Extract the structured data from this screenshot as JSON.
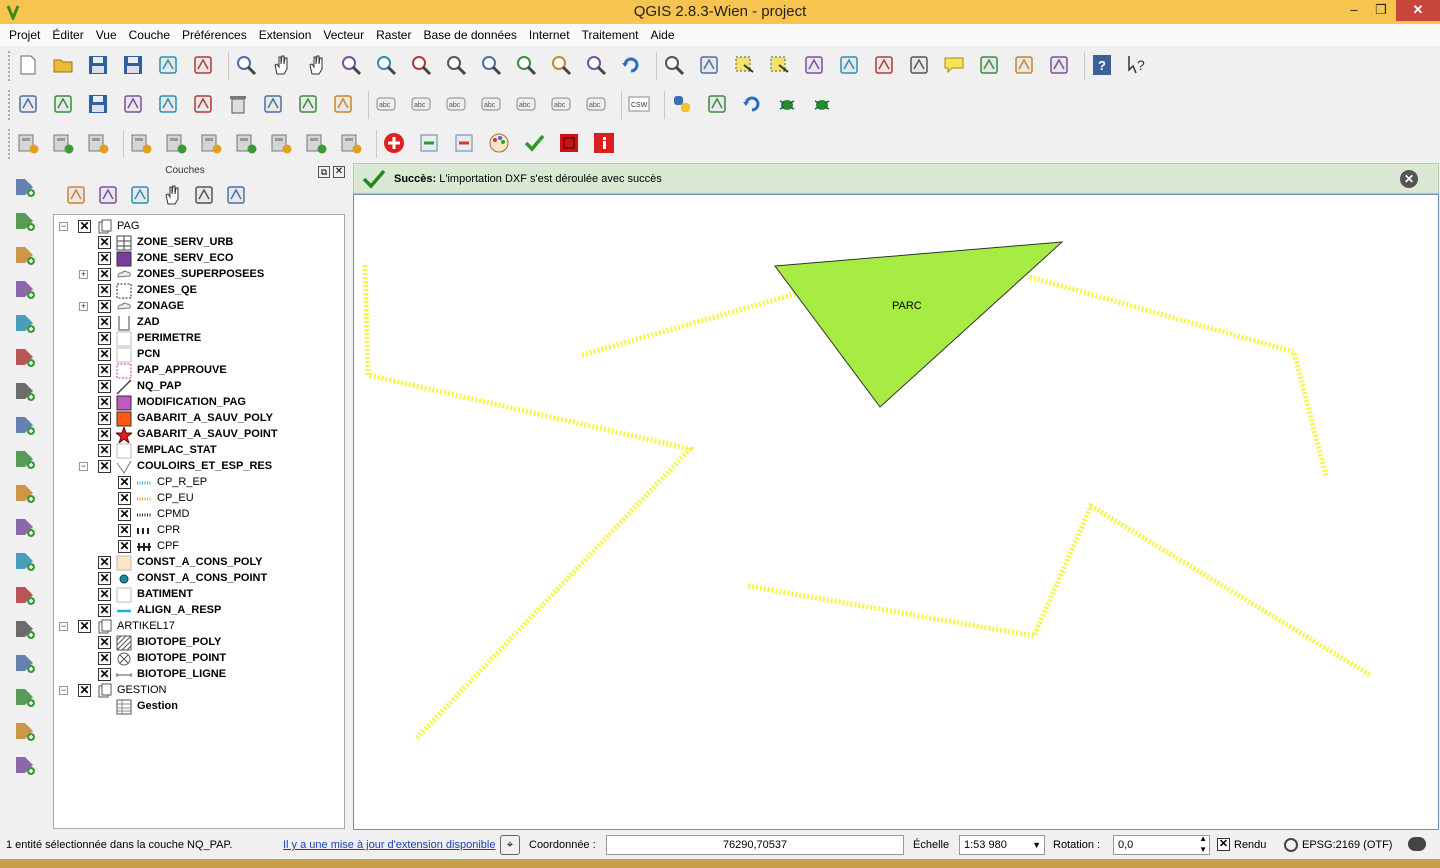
{
  "window": {
    "title": "QGIS 2.8.3-Wien - project",
    "minimize": "–",
    "maximize": "❒",
    "close": "✕"
  },
  "menu": [
    "Projet",
    "Éditer",
    "Vue",
    "Couche",
    "Préférences",
    "Extension",
    "Vecteur",
    "Raster",
    "Base de données",
    "Internet",
    "Traitement",
    "Aide"
  ],
  "toolbars": {
    "row1": [
      "new-project-icon",
      "open-project-icon",
      "save-project-icon",
      "save-as-icon",
      "new-print-composer-icon",
      "composer-manager-icon",
      "|",
      "touch-zoom-icon",
      "pan-icon",
      "pan-to-selection-icon",
      "zoom-in-icon",
      "zoom-out-icon",
      "zoom-actual-icon",
      "zoom-full-icon",
      "zoom-to-selection-icon",
      "zoom-to-layer-icon",
      "zoom-last-icon",
      "zoom-next-icon",
      "refresh-icon",
      "|",
      "identify-icon",
      "action-icon",
      "select-feature-icon",
      "deselect-icon",
      "field-calculator-icon",
      "attribute-table-icon",
      "statistics-icon",
      "measure-icon",
      "map-tip-icon",
      "new-bookmark-icon",
      "show-bookmarks-icon",
      "text-annotation-icon",
      "|",
      "help-icon",
      "whats-this-icon"
    ],
    "row2": [
      "current-edits-icon",
      "toggle-editing-icon",
      "save-edits-icon",
      "add-feature-icon",
      "move-feature-icon",
      "node-tool-icon",
      "delete-selected-icon",
      "cut-features-icon",
      "copy-features-icon",
      "paste-features-icon",
      "|",
      "label-icon",
      "highlight-pinned-label-icon",
      "pin-label-icon",
      "show-hide-label-icon",
      "move-label-icon",
      "rotate-label-icon",
      "change-label-icon",
      "|",
      "csw-icon",
      "|",
      "python-console-icon",
      "plugin-tool-icon",
      "undo-plugin-icon",
      "plugin-bug-icon",
      "plugin-gear-bug-icon"
    ],
    "row3": [
      "add-layer-a-icon",
      "add-layer-b-icon",
      "add-layer-c-icon",
      "|",
      "new-shape-a-icon",
      "new-shape-b-icon",
      "new-shape-c-icon",
      "new-shape-d-icon",
      "new-shape-e-icon",
      "new-shape-f-icon",
      "new-shape-g-icon",
      "|",
      "plus-circle-icon",
      "import-icon",
      "export-icon",
      "color-palette-icon",
      "check-icon",
      "red-square-icon",
      "red-info-icon"
    ]
  },
  "left_toolbar": [
    "add-vector-layer-icon",
    "add-raster-layer-icon",
    "add-postgis-layer-icon",
    "add-spatialite-layer-icon",
    "add-mssql-layer-icon",
    "add-oracle-layer-icon",
    "add-db2-layer-icon",
    "add-wms-layer-icon",
    "add-wcs-layer-icon",
    "add-wfs-layer-icon",
    "add-delimited-text-icon",
    "new-shapefile-icon",
    "virtual-layer-icon",
    "georeferencer-icon",
    "gps-tool-icon",
    "coordinate-capture-icon",
    "vertex-tool-icon",
    "geometry-checker-icon"
  ],
  "layers_panel": {
    "title": "Couches",
    "float_btn": "⧉",
    "close_btn": "✕",
    "panel_tools": [
      "add-group-icon",
      "visibility-icon",
      "filter-icon",
      "expand-icon",
      "collapse-icon",
      "remove-layer-icon"
    ],
    "items": [
      {
        "name": "PAG",
        "level": 0,
        "bold": false,
        "group": true,
        "expander": "−",
        "symbol": "group"
      },
      {
        "name": "ZONE_SERV_URB",
        "level": 1,
        "bold": true,
        "symbol": "grid"
      },
      {
        "name": "ZONE_SERV_ECO",
        "level": 1,
        "bold": true,
        "symbol": "purple-fill"
      },
      {
        "name": "ZONES_SUPERPOSEES",
        "level": 1,
        "bold": true,
        "expander": "+",
        "symbol": "cloud"
      },
      {
        "name": "ZONES_QE",
        "level": 1,
        "bold": true,
        "symbol": "dashed-box"
      },
      {
        "name": "ZONAGE",
        "level": 1,
        "bold": true,
        "expander": "+",
        "symbol": "cloud"
      },
      {
        "name": "ZAD",
        "level": 1,
        "bold": true,
        "symbol": "bracket"
      },
      {
        "name": "PERIMETRE",
        "level": 1,
        "bold": true,
        "symbol": "white-box"
      },
      {
        "name": "PCN",
        "level": 1,
        "bold": true,
        "symbol": "white-box"
      },
      {
        "name": "PAP_APPROUVE",
        "level": 1,
        "bold": true,
        "symbol": "pink-dashed"
      },
      {
        "name": "NQ_PAP",
        "level": 1,
        "bold": true,
        "symbol": "diagonal-line"
      },
      {
        "name": "MODIFICATION_PAG",
        "level": 1,
        "bold": true,
        "symbol": "violet-fill"
      },
      {
        "name": "GABARIT_A_SAUV_POLY",
        "level": 1,
        "bold": true,
        "symbol": "orange-fill"
      },
      {
        "name": "GABARIT_A_SAUV_POINT",
        "level": 1,
        "bold": true,
        "symbol": "red-star"
      },
      {
        "name": "EMPLAC_STAT",
        "level": 1,
        "bold": true,
        "symbol": "white-box"
      },
      {
        "name": "COULOIRS_ET_ESP_RES",
        "level": 1,
        "bold": true,
        "expander": "−",
        "symbol": "v-line"
      },
      {
        "name": "CP_R_EP",
        "level": 2,
        "bold": false,
        "symbol": "blue-dotted"
      },
      {
        "name": "CP_EU",
        "level": 2,
        "bold": false,
        "symbol": "orange-dotted"
      },
      {
        "name": "CPMD",
        "level": 2,
        "bold": false,
        "symbol": "black-dotted"
      },
      {
        "name": "CPR",
        "level": 2,
        "bold": false,
        "symbol": "black-dashed"
      },
      {
        "name": "CPF",
        "level": 2,
        "bold": false,
        "symbol": "black-hbar"
      },
      {
        "name": "CONST_A_CONS_POLY",
        "level": 1,
        "bold": true,
        "symbol": "beige-fill"
      },
      {
        "name": "CONST_A_CONS_POINT",
        "level": 1,
        "bold": true,
        "symbol": "teal-dot"
      },
      {
        "name": "BATIMENT",
        "level": 1,
        "bold": true,
        "symbol": "white-box"
      },
      {
        "name": "ALIGN_A_RESP",
        "level": 1,
        "bold": true,
        "symbol": "cyan-line"
      },
      {
        "name": "ARTIKEL17",
        "level": 0,
        "bold": false,
        "group": true,
        "expander": "−",
        "symbol": "group"
      },
      {
        "name": "BIOTOPE_POLY",
        "level": 1,
        "bold": true,
        "symbol": "hatched"
      },
      {
        "name": "BIOTOPE_POINT",
        "level": 1,
        "bold": true,
        "symbol": "circle-x"
      },
      {
        "name": "BIOTOPE_LIGNE",
        "level": 1,
        "bold": true,
        "symbol": "line-bracket"
      },
      {
        "name": "GESTION",
        "level": 0,
        "bold": false,
        "group": true,
        "expander": "−",
        "symbol": "group"
      },
      {
        "name": "Gestion",
        "level": 1,
        "bold": true,
        "nocheck": true,
        "symbol": "table"
      }
    ]
  },
  "message": {
    "title": "Succès:",
    "text": "L'importation DXF s'est déroulée avec succès",
    "close": "✕"
  },
  "map": {
    "label": "PARC",
    "polygon_fill": "#a6ec42",
    "line_color": "#f5f542"
  },
  "status": {
    "selection": "1 entité sélectionnée dans la couche NQ_PAP.",
    "update_link": "Il y a une mise à jour d'extension disponible",
    "coord_label": "Coordonnée :",
    "coord_value": "76290,70537",
    "scale_label": "Échelle",
    "scale_value": "1:53 980",
    "rotation_label": "Rotation :",
    "rotation_value": "0,0",
    "render_label": "Rendu",
    "render_check": "✕",
    "crs": "EPSG:2169 (OTF)"
  }
}
